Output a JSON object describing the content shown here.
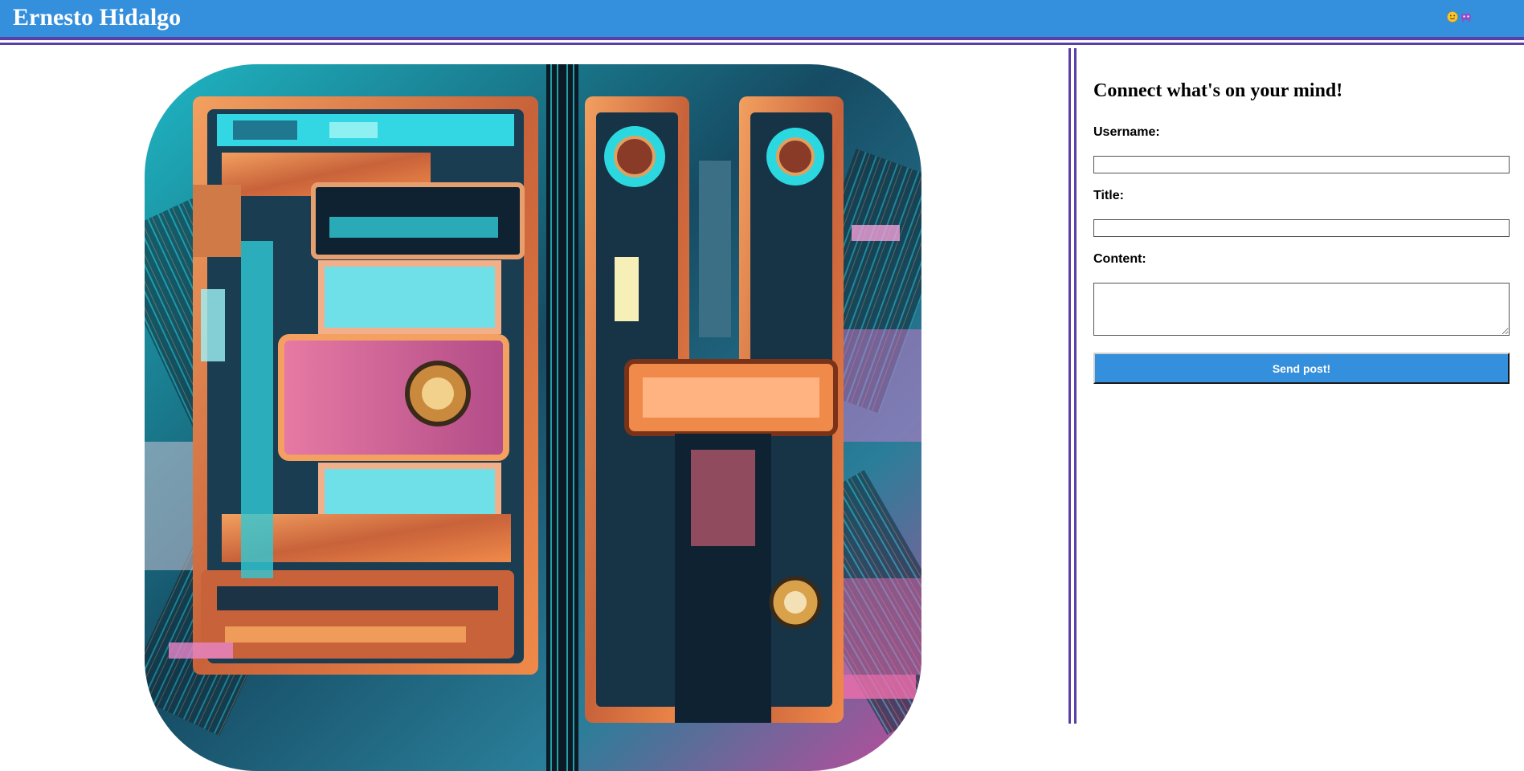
{
  "site": {
    "title": "Ernesto Hidalgo",
    "accent_color": "#348fdc",
    "border_color": "#5b3fa6"
  },
  "header": {
    "icons": [
      "smiley-face-emoji-icon",
      "alien-monster-emoji-icon"
    ]
  },
  "artwork": {
    "description_icon": "cyberpunk-circuit-artwork"
  },
  "form": {
    "heading": "Connect what's on your mind!",
    "username_label": "Username:",
    "username_value": "",
    "title_label": "Title:",
    "title_value": "",
    "content_label": "Content:",
    "content_value": "",
    "submit_label": "Send post!"
  }
}
